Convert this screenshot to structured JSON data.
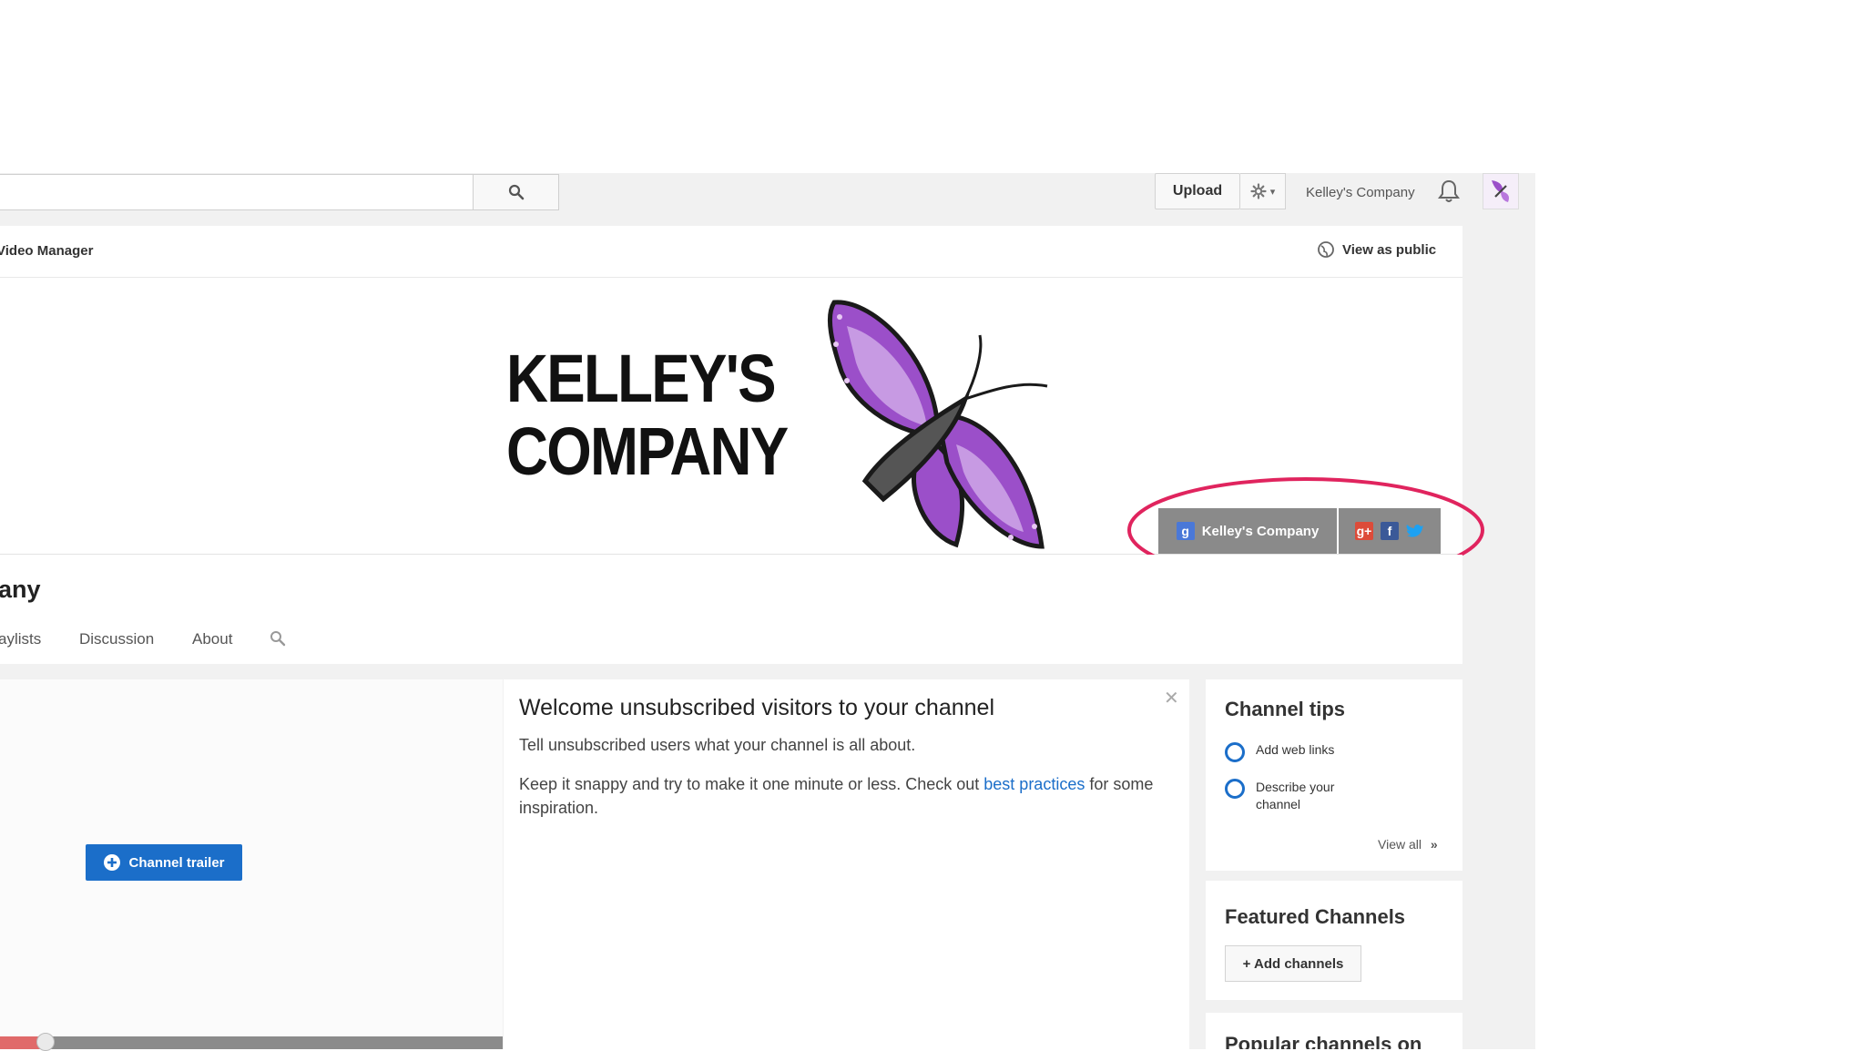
{
  "search": {
    "placeholder": ""
  },
  "header": {
    "upload_label": "Upload",
    "account_name": "Kelley's Company"
  },
  "nav": {
    "video_manager": "Video Manager",
    "view_as_public": "View as public"
  },
  "banner": {
    "title_line1": "KELLEY'S",
    "title_line2": "COMPANY",
    "social_name": "Kelley's Company",
    "social_icons": [
      "google-plus",
      "facebook",
      "twitter"
    ]
  },
  "channel": {
    "name": "any",
    "tabs": [
      "aylists",
      "Discussion",
      "About"
    ]
  },
  "trailer": {
    "button_label": "Channel trailer",
    "progress": 0.08
  },
  "welcome": {
    "title": "Welcome unsubscribed visitors to your channel",
    "line1": "Tell unsubscribed users what your channel is all about.",
    "line2_before": "Keep it snappy and try to make it one minute or less. Check out ",
    "line2_link": "best practices",
    "line2_after": " for some inspiration."
  },
  "tips": {
    "title": "Channel tips",
    "items": [
      "Add web links",
      "Describe your channel"
    ],
    "view_all": "View all"
  },
  "featured": {
    "title": "Featured Channels",
    "add_label": "+ Add channels"
  },
  "popular": {
    "title": "Popular channels on"
  },
  "colors": {
    "accent_blue": "#1b6ec9",
    "highlight_red": "#e0245e",
    "butterfly_purple": "#9b4fc9"
  }
}
